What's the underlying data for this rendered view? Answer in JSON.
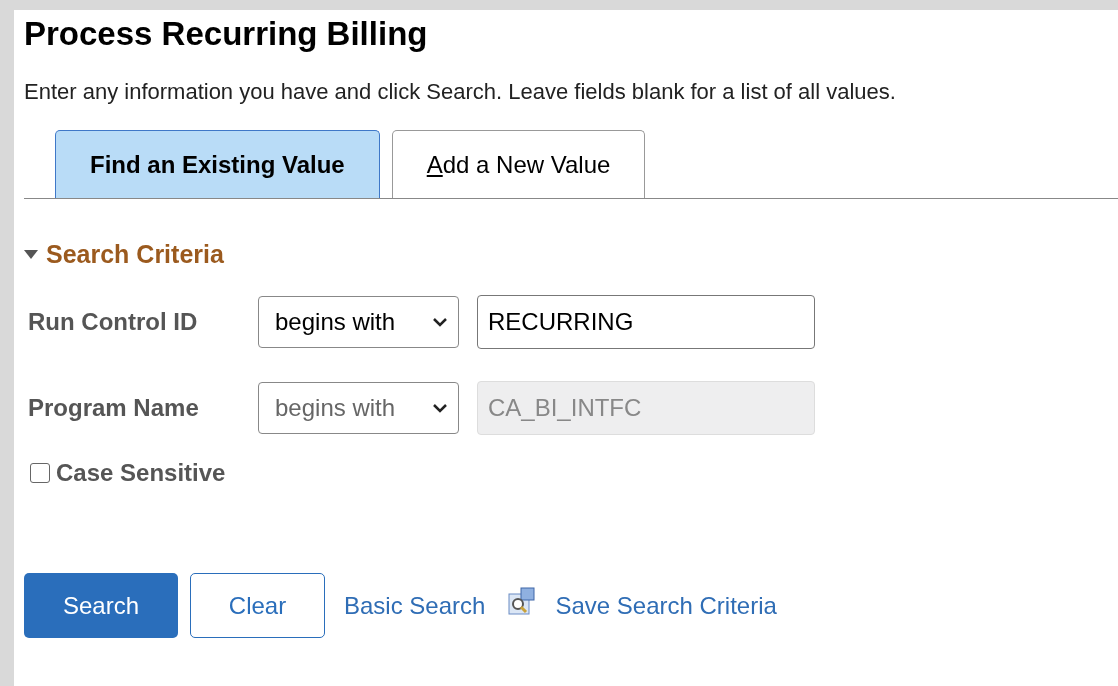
{
  "title": "Process Recurring Billing",
  "instructions": "Enter any information you have and click Search. Leave fields blank for a list of all values.",
  "tabs": [
    {
      "label": "Find an Existing Value",
      "selected": true
    },
    {
      "label": "Add a New Value",
      "selected": false
    }
  ],
  "search_criteria": {
    "heading": "Search Criteria",
    "expanded": true,
    "fields": [
      {
        "label": "Run Control ID",
        "operator": "begins with",
        "value": "RECURRING",
        "disabled": false
      },
      {
        "label": "Program Name",
        "operator": "begins with",
        "value": "CA_BI_INTFC",
        "disabled": true
      }
    ],
    "case_sensitive": {
      "label": "Case Sensitive",
      "checked": false
    }
  },
  "actions": [
    {
      "kind": "primary",
      "label": "Search"
    },
    {
      "kind": "secondary",
      "label": "Clear"
    },
    {
      "kind": "link",
      "label": "Basic Search"
    },
    {
      "kind": "icon-link",
      "label": "Save Search Criteria"
    }
  ]
}
